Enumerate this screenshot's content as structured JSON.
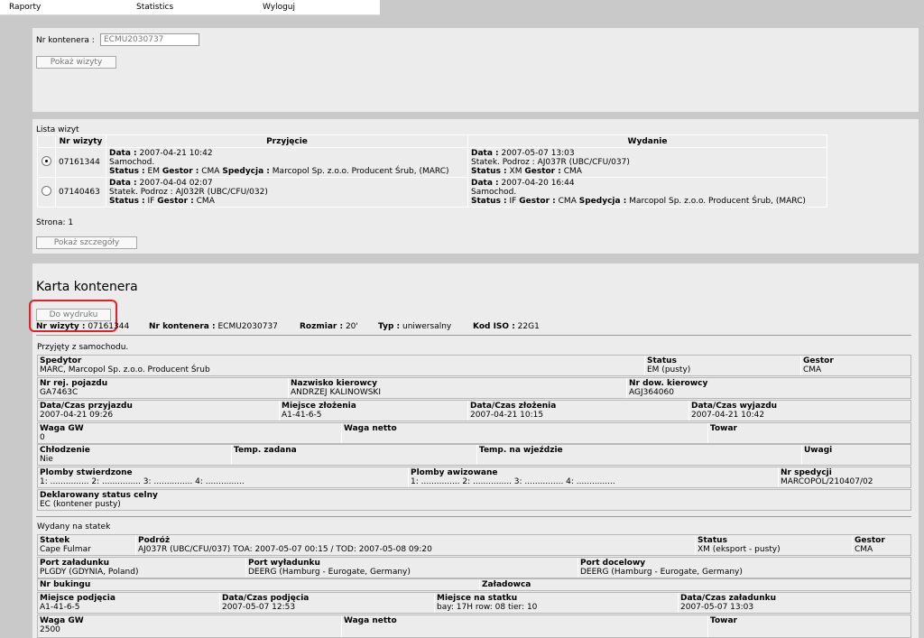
{
  "menu": {
    "items": [
      "Raporty",
      "Statistics",
      "Wyloguj"
    ]
  },
  "search": {
    "label": "Nr kontenera :",
    "value": "ECMU2030737",
    "button": "Pokaż wizyty"
  },
  "visits": {
    "title": "Lista wizyt",
    "headers": [
      "Nr wizyty",
      "Przyjęcie",
      "Wydanie"
    ],
    "rows": [
      {
        "selected": true,
        "nr": "07161344",
        "in": {
          "data_label": "Data :",
          "data": "2007-04-21 10:42",
          "line2": "Samochod.",
          "status_label": "Status :",
          "status": "EM",
          "gestor_label": "Gestor :",
          "gestor": "CMA",
          "sped_label": "Spedycja :",
          "sped": "Marcopol Sp. z.o.o. Producent Śrub, (MARC)"
        },
        "out": {
          "data_label": "Data :",
          "data": "2007-05-07 13:03",
          "line2": "Statek. Podroz : AJ037R (UBC/CFU/037)",
          "status_label": "Status :",
          "status": "XM",
          "gestor_label": "Gestor :",
          "gestor": "CMA",
          "sped_label": "",
          "sped": ""
        }
      },
      {
        "selected": false,
        "nr": "07140463",
        "in": {
          "data_label": "Data :",
          "data": "2007-04-04 02:07",
          "line2": "Statek. Podroz : AJ032R (UBC/CFU/032)",
          "status_label": "Status :",
          "status": "IF",
          "gestor_label": "Gestor :",
          "gestor": "CMA",
          "sped_label": "",
          "sped": ""
        },
        "out": {
          "data_label": "Data :",
          "data": "2007-04-20 16:44",
          "line2": "Samochod.",
          "status_label": "Status :",
          "status": "IF",
          "gestor_label": "Gestor :",
          "gestor": "CMA",
          "sped_label": "Spedycja :",
          "sped": "Marcopol Sp. z.o.o. Producent Śrub, (MARC)"
        }
      }
    ],
    "page": "Strona: 1",
    "details_button": "Pokaż szczegóły"
  },
  "card": {
    "title": "Karta kontenera",
    "print_button": "Do wydruku",
    "summary": [
      {
        "label": "Nr wizyty :",
        "value": "07161344"
      },
      {
        "label": "Nr kontenera :",
        "value": "ECMU2030737"
      },
      {
        "label": "Rozmiar :",
        "value": "20'"
      },
      {
        "label": "Typ :",
        "value": "uniwersalny"
      },
      {
        "label": "Kod ISO :",
        "value": "22G1"
      }
    ],
    "received": {
      "title": "Przyjęty z samochodu.",
      "rows": [
        [
          {
            "label": "Spedytor",
            "value": "MARC, Marcopol Sp. z.o.o. Producent Śrub"
          },
          {
            "label": "Status",
            "value": "EM (pusty)"
          },
          {
            "label": "Gestor",
            "value": "CMA"
          }
        ],
        [
          {
            "label": "Nr rej. pojazdu",
            "value": "GA7463C"
          },
          {
            "label": "Nazwisko kierowcy",
            "value": "ANDRZEJ KALINOWSKI"
          },
          {
            "label": "Nr dow. kierowcy",
            "value": "AGJ364060"
          }
        ],
        [
          {
            "label": "Data/Czas przyjazdu",
            "value": "2007-04-21 09:26"
          },
          {
            "label": "Miejsce złożenia",
            "value": "A1-41-6-5"
          },
          {
            "label": "Data/Czas złożenia",
            "value": "2007-04-21 10:15"
          },
          {
            "label": "Data/Czas wyjazdu",
            "value": "2007-04-21 10:42"
          }
        ],
        [
          {
            "label": "Waga GW",
            "value": "0"
          },
          {
            "label": "Waga netto",
            "value": ""
          },
          {
            "label": "Towar",
            "value": ""
          }
        ],
        [
          {
            "label": "Chłodzenie",
            "value": "Nie"
          },
          {
            "label": "Temp. zadana",
            "value": ""
          },
          {
            "label": "Temp. na wjeździe",
            "value": ""
          },
          {
            "label": "Uwagi",
            "value": ""
          }
        ],
        [
          {
            "label": "Plomby stwierdzone",
            "value": "1: ............... 2: ............... 3: ............... 4: ..............."
          },
          {
            "label": "Plomby awizowane",
            "value": "1: ............... 2: ............... 3: ............... 4: ..............."
          },
          {
            "label": "Nr spedycji",
            "value": "MARCOPOL/210407/02"
          }
        ],
        [
          {
            "label": "Deklarowany status celny",
            "value": "EC (kontener pusty)"
          }
        ]
      ]
    },
    "released": {
      "title": "Wydany na statek",
      "rows": [
        [
          {
            "label": "Statek",
            "value": "Cape Fulmar"
          },
          {
            "label": "Podróż",
            "value": "AJ037R (UBC/CFU/037) TOA: 2007-05-07 00:15 / TOD: 2007-05-08 09:20"
          },
          {
            "label": "Status",
            "value": "XM (eksport - pusty)"
          },
          {
            "label": "Gestor",
            "value": "CMA"
          }
        ],
        [
          {
            "label": "Port załadunku",
            "value": "PLGDY (GDYNIA, Poland)"
          },
          {
            "label": "Port wyładunku",
            "value": "DEERG (Hamburg - Eurogate, Germany)"
          },
          {
            "label": "Port docelowy",
            "value": "DEERG (Hamburg - Eurogate, Germany)"
          }
        ],
        [
          {
            "label": "Nr bukingu",
            "value": ""
          },
          {
            "label": "Załadowca",
            "value": ""
          }
        ],
        [
          {
            "label": "Miejsce podjęcia",
            "value": "A1-41-6-5"
          },
          {
            "label": "Data/Czas podjęcia",
            "value": "2007-05-07 12:53"
          },
          {
            "label": "Miejsce na statku",
            "value": "bay: 17H row: 08 tier: 10"
          },
          {
            "label": "Data/Czas załadunku",
            "value": "2007-05-07 13:03"
          }
        ],
        [
          {
            "label": "Waga GW",
            "value": "2500"
          },
          {
            "label": "Waga netto",
            "value": ""
          },
          {
            "label": "Towar",
            "value": ""
          }
        ]
      ]
    }
  },
  "colors": {
    "highlight": "#e0202a",
    "panel": "#ececec",
    "background": "#c9c9c9"
  }
}
